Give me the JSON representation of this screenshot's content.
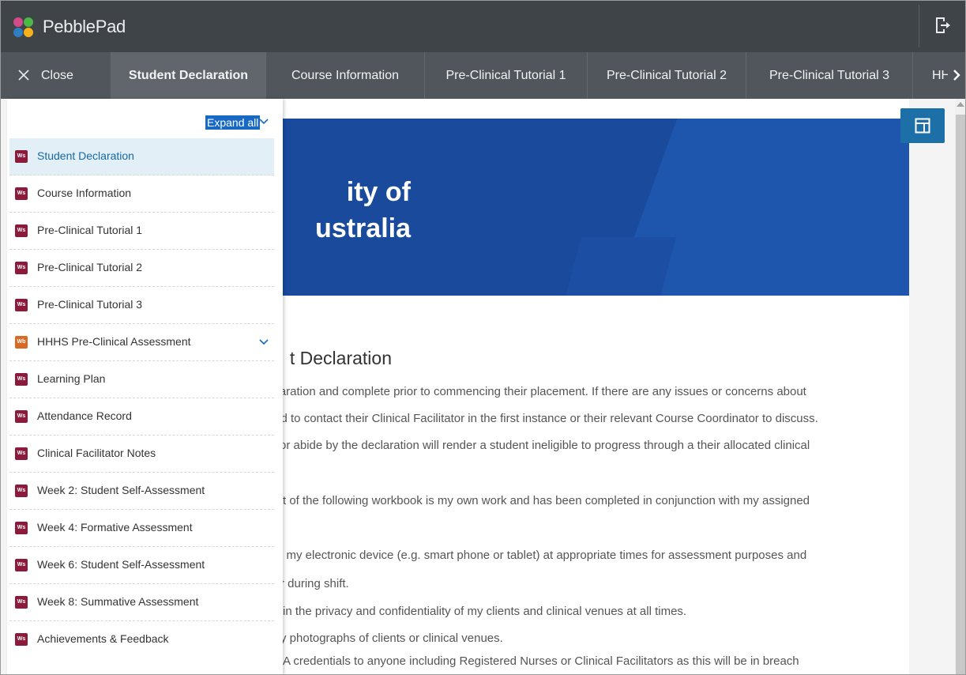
{
  "app": {
    "name": "PebblePad",
    "logout_icon": "logout-icon"
  },
  "tabs": {
    "close_label": "Close",
    "items": [
      {
        "label": "Student Declaration",
        "active": true
      },
      {
        "label": "Course Information"
      },
      {
        "label": "Pre-Clinical Tutorial 1"
      },
      {
        "label": "Pre-Clinical Tutorial 2"
      },
      {
        "label": "Pre-Clinical Tutorial 3"
      },
      {
        "label": "HH"
      }
    ]
  },
  "sidebar": {
    "expand_all": "Expand all",
    "items": [
      {
        "label": "Student Declaration",
        "badge": "Ws",
        "selected": true
      },
      {
        "label": "Course Information",
        "badge": "Ws"
      },
      {
        "label": "Pre-Clinical Tutorial 1",
        "badge": "Ws"
      },
      {
        "label": "Pre-Clinical Tutorial 2",
        "badge": "Ws"
      },
      {
        "label": "Pre-Clinical Tutorial 3",
        "badge": "Ws"
      },
      {
        "label": "HHHS Pre-Clinical Assessment",
        "badge": "Wb",
        "expandable": true
      },
      {
        "label": "Learning Plan",
        "badge": "Ws"
      },
      {
        "label": "Attendance Record",
        "badge": "Ws"
      },
      {
        "label": "Clinical Facilitator Notes",
        "badge": "Ws"
      },
      {
        "label": "Week 2: Student Self-Assessment",
        "badge": "Ws"
      },
      {
        "label": "Week 4: Formative Assessment",
        "badge": "Ws"
      },
      {
        "label": "Week 6: Student Self-Assessment",
        "badge": "Ws"
      },
      {
        "label": "Week 8: Summative Assessment",
        "badge": "Ws"
      },
      {
        "label": "Achievements & Feedback",
        "badge": "Ws"
      }
    ]
  },
  "document": {
    "banner_line1": "ity of",
    "banner_line2": "ustralia",
    "heading": "t Declaration",
    "paragraphs": [
      "claration and complete prior to commencing their placement.  If there are any issues or concerns about",
      "ted to contact their Clinical Facilitator in the first instance or their relevant Course Coordinator to discuss.",
      " or abide by the declaration will render a student ineligible to progress through a their allocated clinical",
      "t of the following workbook is my own work and has been completed in conjunction with my assigned",
      "e my electronic device (e.g. smart phone or tablet) at appropriate times for assessment purposes and",
      "r during shift.",
      "in the privacy and confidentiality of my clients and clinical venues at all times.",
      "y photographs of clients or clinical venues.",
      "A credentials to anyone including Registered Nurses or Clinical Facilitators as this will be in breach"
    ]
  },
  "colors": {
    "appbar": "#3f4448",
    "tabbar": "#50565b",
    "accent": "#1d6fa8",
    "banner": "#1a4a9c",
    "worksheet_badge": "#8b1a3b",
    "workbook_badge": "#d96a24"
  }
}
